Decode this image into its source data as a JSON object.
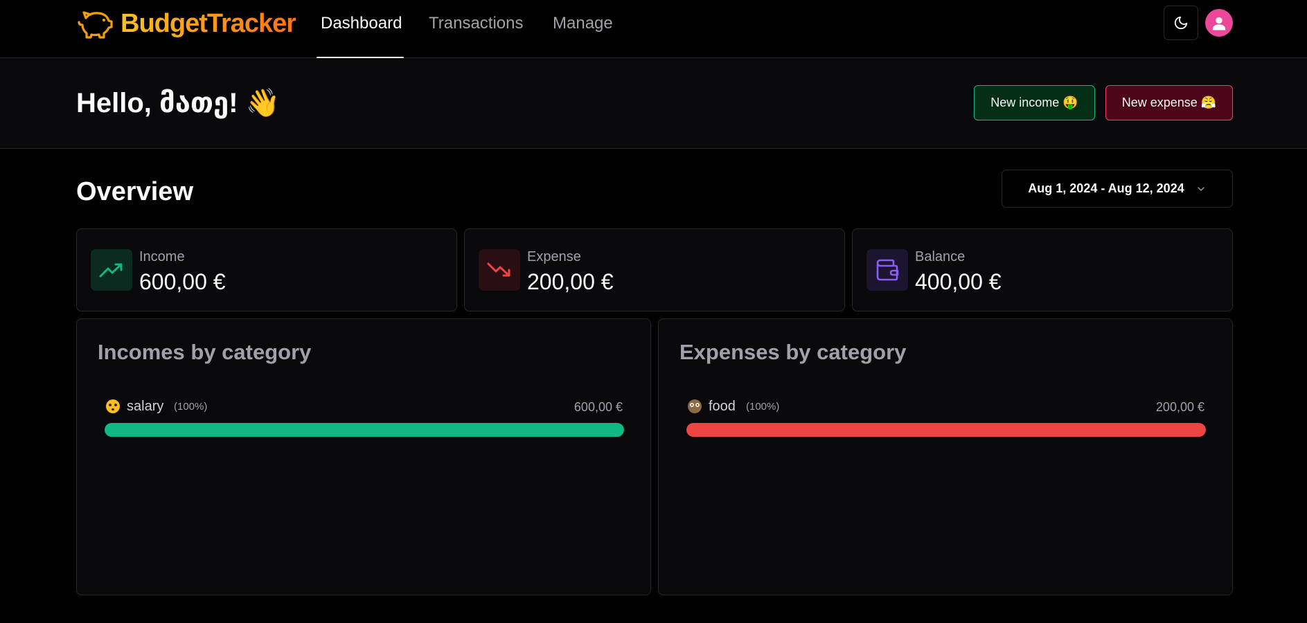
{
  "app": {
    "name": "BudgetTracker",
    "brand_color": "#f59e0b"
  },
  "nav": {
    "links": [
      {
        "label": "Dashboard",
        "active": true
      },
      {
        "label": "Transactions",
        "active": false
      },
      {
        "label": "Manage",
        "active": false
      }
    ],
    "theme_icon": "moon-icon",
    "user_icon": "user-icon"
  },
  "header": {
    "greeting": "Hello, მათე! 👋",
    "new_income_label": "New income 🤑",
    "new_expense_label": "New expense 😤"
  },
  "overview": {
    "title": "Overview",
    "date_range": "Aug 1, 2024 - Aug 12, 2024"
  },
  "stats": {
    "income": {
      "label": "Income",
      "value": "600,00 €",
      "icon": "trending-up-icon",
      "color": "#10b981"
    },
    "expense": {
      "label": "Expense",
      "value": "200,00 €",
      "icon": "trending-down-icon",
      "color": "#ef4444"
    },
    "balance": {
      "label": "Balance",
      "value": "400,00 €",
      "icon": "wallet-icon",
      "color": "#8b5cf6"
    }
  },
  "incomes_by_category": {
    "title": "Incomes by category",
    "items": [
      {
        "emoji": "😳",
        "name": "salary",
        "percent_label": "(100%)",
        "amount": "600,00 €",
        "share": 1.0,
        "color": "#10b981"
      }
    ]
  },
  "expenses_by_category": {
    "title": "Expenses by category",
    "items": [
      {
        "emoji": "🦉",
        "name": "food",
        "percent_label": "(100%)",
        "amount": "200,00 €",
        "share": 1.0,
        "color": "#ef4444"
      }
    ]
  }
}
